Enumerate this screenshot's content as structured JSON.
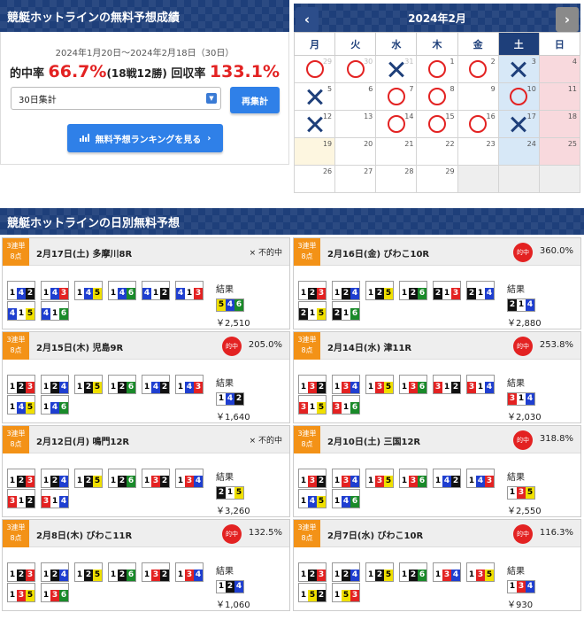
{
  "summary": {
    "header": "競艇ホットラインの無料予想成績",
    "period": "2024年1月20日〜2024年2月18日（30日）",
    "hit_label": "的中率",
    "hit_rate": "66.7%",
    "hit_detail": "(18戦12勝)",
    "return_label": "回収率",
    "return_rate": "133.1%",
    "select_value": "30日集計",
    "recalc_button": "再集計",
    "ranking_button": "無料予想ランキングを見る"
  },
  "calendar": {
    "title": "2024年2月",
    "prev": "‹",
    "next": "›",
    "weekdays": [
      "月",
      "火",
      "水",
      "木",
      "金",
      "土",
      "日"
    ],
    "weeks": [
      [
        {
          "d": "29",
          "m": "o",
          "f": 1
        },
        {
          "d": "30",
          "m": "o",
          "f": 1
        },
        {
          "d": "31",
          "m": "x",
          "f": 1
        },
        {
          "d": "1",
          "m": "o"
        },
        {
          "d": "2",
          "m": "o"
        },
        {
          "d": "3",
          "m": "x"
        },
        {
          "d": "4"
        }
      ],
      [
        {
          "d": "5",
          "m": "x"
        },
        {
          "d": "6"
        },
        {
          "d": "7",
          "m": "o"
        },
        {
          "d": "8",
          "m": "o"
        },
        {
          "d": "9"
        },
        {
          "d": "10",
          "m": "o"
        },
        {
          "d": "11"
        }
      ],
      [
        {
          "d": "12",
          "m": "x"
        },
        {
          "d": "13"
        },
        {
          "d": "14",
          "m": "o"
        },
        {
          "d": "15",
          "m": "o"
        },
        {
          "d": "16",
          "m": "o"
        },
        {
          "d": "17",
          "m": "x"
        },
        {
          "d": "18"
        }
      ],
      [
        {
          "d": "19",
          "t": 1
        },
        {
          "d": "20"
        },
        {
          "d": "21"
        },
        {
          "d": "22"
        },
        {
          "d": "23"
        },
        {
          "d": "24"
        },
        {
          "d": "25"
        }
      ],
      [
        {
          "d": "26"
        },
        {
          "d": "27"
        },
        {
          "d": "28"
        },
        {
          "d": "29"
        },
        {
          "d": "",
          "b": 1
        },
        {
          "d": "",
          "b": 1
        },
        {
          "d": "",
          "b": 1
        }
      ]
    ]
  },
  "daily": {
    "header": "競艇ホットラインの日別無料予想",
    "tag_line1": "3連単",
    "tag_line2": "8点",
    "result_label": "結果",
    "cards": [
      {
        "title": "2月17日(土) 多摩川8R",
        "status": "miss",
        "status_text": "× 不的中",
        "rate": "",
        "combos": [
          "142",
          "143",
          "145",
          "146",
          "412",
          "413",
          "415",
          "416"
        ],
        "result": "546",
        "payout": "￥2,510"
      },
      {
        "title": "2月16日(金) びわこ10R",
        "status": "hit",
        "status_text": "的中",
        "rate": "360.0%",
        "combos": [
          "123",
          "124",
          "125",
          "126",
          "213",
          "214",
          "215",
          "216"
        ],
        "result": "214",
        "payout": "￥2,880"
      },
      {
        "title": "2月15日(木) 児島9R",
        "status": "hit",
        "status_text": "的中",
        "rate": "205.0%",
        "combos": [
          "123",
          "124",
          "125",
          "126",
          "142",
          "143",
          "145",
          "146"
        ],
        "result": "142",
        "payout": "￥1,640"
      },
      {
        "title": "2月14日(水) 津11R",
        "status": "hit",
        "status_text": "的中",
        "rate": "253.8%",
        "combos": [
          "132",
          "134",
          "135",
          "136",
          "312",
          "314",
          "315",
          "316"
        ],
        "result": "314",
        "payout": "￥2,030"
      },
      {
        "title": "2月12日(月) 鳴門12R",
        "status": "miss",
        "status_text": "× 不的中",
        "rate": "",
        "combos": [
          "123",
          "124",
          "125",
          "126",
          "132",
          "134",
          "312",
          "314"
        ],
        "result": "215",
        "payout": "￥3,260"
      },
      {
        "title": "2月10日(土) 三国12R",
        "status": "hit",
        "status_text": "的中",
        "rate": "318.8%",
        "combos": [
          "132",
          "134",
          "135",
          "136",
          "142",
          "143",
          "145",
          "146"
        ],
        "result": "135",
        "payout": "￥2,550"
      },
      {
        "title": "2月8日(木) びわこ11R",
        "status": "hit",
        "status_text": "的中",
        "rate": "132.5%",
        "combos": [
          "123",
          "124",
          "125",
          "126",
          "132",
          "134",
          "135",
          "136"
        ],
        "result": "124",
        "payout": "￥1,060"
      },
      {
        "title": "2月7日(水) びわこ10R",
        "status": "hit",
        "status_text": "的中",
        "rate": "116.3%",
        "combos": [
          "123",
          "124",
          "125",
          "126",
          "134",
          "135",
          "152",
          "153"
        ],
        "result": "134",
        "payout": "￥930"
      }
    ]
  }
}
